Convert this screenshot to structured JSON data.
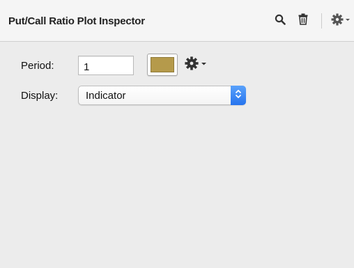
{
  "inspector": {
    "title": "Put/Call Ratio Plot Inspector"
  },
  "header_icons": {
    "search": "search-icon",
    "trash": "trash-icon",
    "gear_menu": "gear-menu-icon"
  },
  "period": {
    "label": "Period:",
    "value": "1"
  },
  "color": {
    "swatch": "#b59a4b"
  },
  "display": {
    "label": "Display:",
    "selected": "Indicator"
  }
}
